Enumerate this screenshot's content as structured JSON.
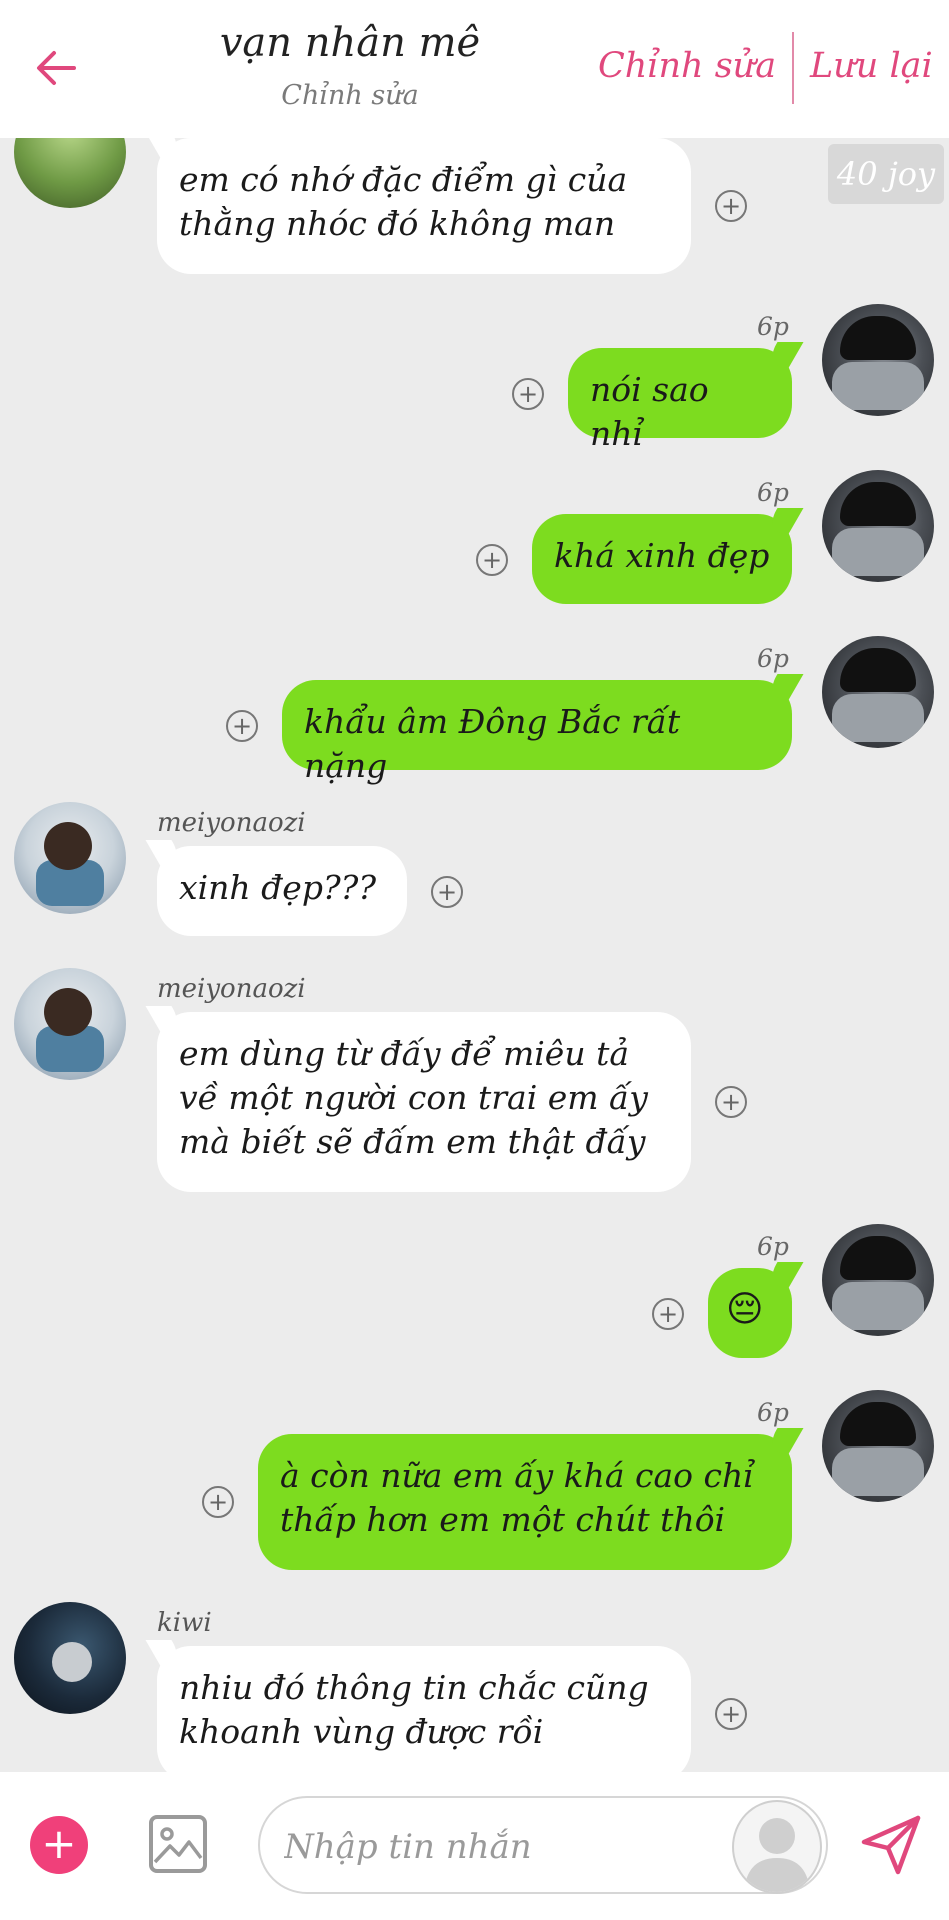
{
  "header": {
    "title": "vạn nhân mê",
    "subtitle": "Chỉnh sửa",
    "edit_label": "Chỉnh sửa",
    "save_label": "Lưu lại",
    "accent_color": "#e0487d"
  },
  "badge": {
    "label": "40 joy"
  },
  "messages": [
    {
      "side": "in",
      "sender": "",
      "text": "em có nhớ đặc điểm gì của\nthằng nhóc đó không man",
      "avatar": "outdoor-photo"
    },
    {
      "side": "out",
      "time": "6p",
      "text": "nói sao nhỉ",
      "avatar": "masked-boy-photo"
    },
    {
      "side": "out",
      "time": "6p",
      "text": "khá xinh đẹp",
      "avatar": "masked-boy-photo"
    },
    {
      "side": "out",
      "time": "6p",
      "text": "khẩu âm Đông Bắc rất nặng",
      "avatar": "masked-boy-photo"
    },
    {
      "side": "in",
      "sender": "meiyonaozi",
      "text": "xinh đẹp???",
      "avatar": "boy-sitting-photo"
    },
    {
      "side": "in",
      "sender": "meiyonaozi",
      "text": "em dùng từ đấy để miêu tả\nvề một người con trai em ấy\nmà biết sẽ đấm em thật đấy",
      "avatar": "boy-sitting-photo"
    },
    {
      "side": "out",
      "time": "6p",
      "text": "😔",
      "avatar": "masked-boy-photo"
    },
    {
      "side": "out",
      "time": "6p",
      "text": "à còn nữa em ấy khá cao chỉ\nthấp hơn em một chút thôi",
      "avatar": "masked-boy-photo"
    },
    {
      "side": "in",
      "sender": "kiwi",
      "text": "nhiu đó thông tin chắc cũng\nkhoanh vùng được rồi",
      "avatar": "night-photo"
    }
  ],
  "composer": {
    "placeholder": "Nhập tin nhắn",
    "value": ""
  },
  "colors": {
    "incoming_bubble": "#ffffff",
    "outgoing_bubble": "#7ddc1f",
    "background": "#ececec",
    "add_button": "#f0407a"
  }
}
